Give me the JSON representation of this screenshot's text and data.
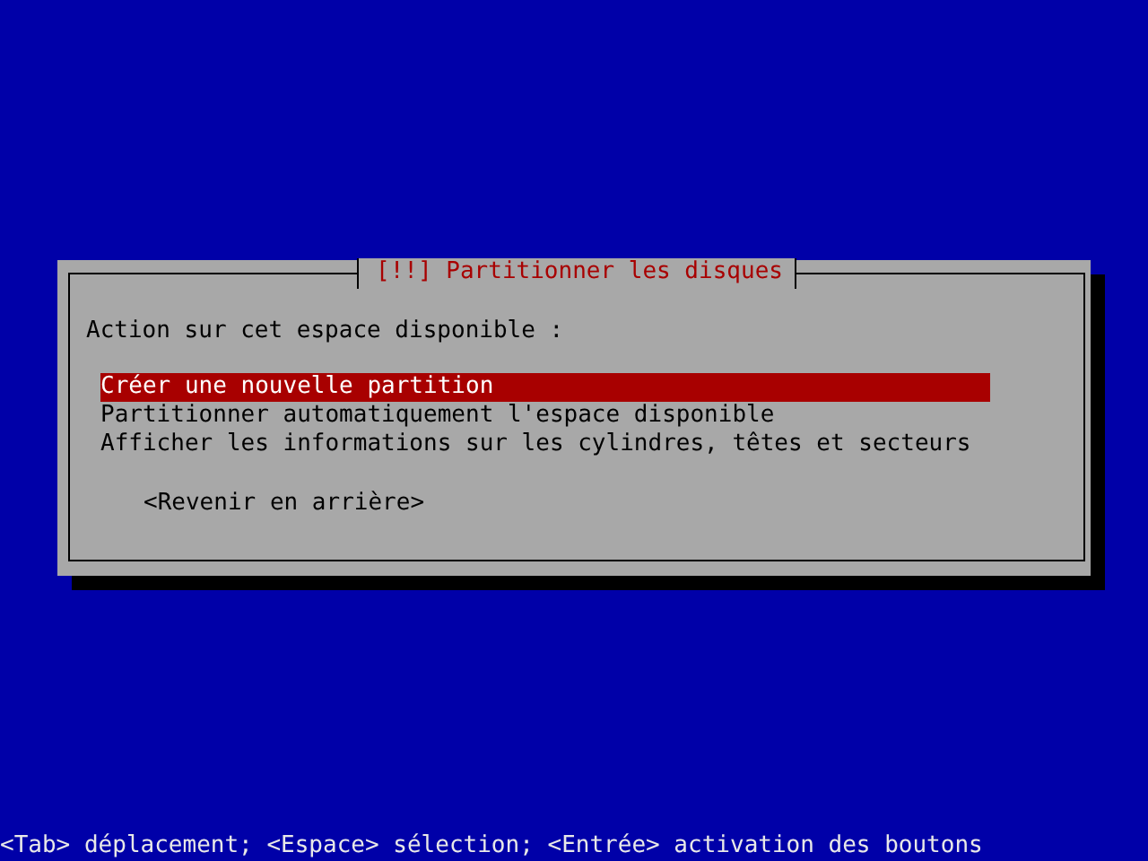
{
  "dialog": {
    "title": "[!!] Partitionner les disques",
    "prompt": "Action sur cet espace disponible :",
    "items": [
      {
        "label": "Créer une nouvelle partition",
        "selected": true
      },
      {
        "label": "Partitionner automatiquement l'espace disponible",
        "selected": false
      },
      {
        "label": "Afficher les informations sur les cylindres, têtes et secteurs",
        "selected": false
      }
    ],
    "buttons": [
      "<Revenir en arrière>"
    ]
  },
  "status_bar": "<Tab> déplacement; <Espace> sélection; <Entrée> activation des boutons"
}
